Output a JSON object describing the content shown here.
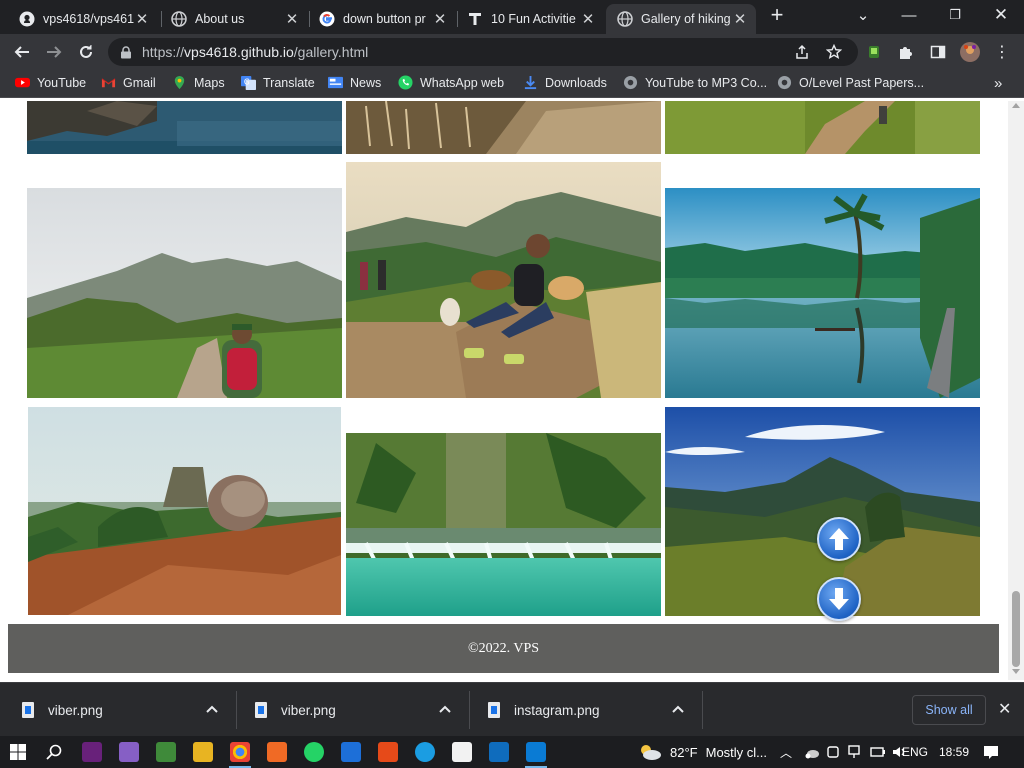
{
  "tabs": [
    {
      "title": "vps4618/vps461",
      "icon": "github-icon"
    },
    {
      "title": "About us",
      "icon": "globe-icon"
    },
    {
      "title": "down button pr",
      "icon": "google-icon"
    },
    {
      "title": "10 Fun Activitie",
      "icon": "t-logo-icon"
    },
    {
      "title": "Gallery of hiking",
      "icon": "globe-icon",
      "active": true
    }
  ],
  "address": {
    "scheme": "https://",
    "host": "vps4618.github.io",
    "path": "/gallery.html"
  },
  "bookmarks": [
    {
      "label": "YouTube",
      "color": "#ff0000"
    },
    {
      "label": "Gmail",
      "color": "#ea4335"
    },
    {
      "label": "Maps",
      "color": "#34a853"
    },
    {
      "label": "Translate",
      "color": "#4285f4"
    },
    {
      "label": "News",
      "color": "#4285f4"
    },
    {
      "label": "WhatsApp web",
      "color": "#25d366"
    },
    {
      "label": "Downloads",
      "color": "#4a8af4"
    },
    {
      "label": "YouTube to MP3 Co...",
      "color": "#9aa0a6"
    },
    {
      "label": "O/Level Past Papers...",
      "color": "#9aa0a6"
    }
  ],
  "bookmarks_overflow": "»",
  "gallery": {
    "photos": [
      {
        "name": "river-rocks-photo"
      },
      {
        "name": "dry-grass-hill-photo"
      },
      {
        "name": "trail-hiker-photo"
      },
      {
        "name": "hiker-green-valley-photo"
      },
      {
        "name": "woman-with-dogs-summit-photo"
      },
      {
        "name": "lake-palm-reflection-photo"
      },
      {
        "name": "sigiriya-rock-view-photo"
      },
      {
        "name": "waterfall-pool-photo"
      },
      {
        "name": "mountain-blue-sky-photo"
      }
    ]
  },
  "footer": {
    "text": "©2022. VPS"
  },
  "downloads": {
    "items": [
      "viber.png",
      "viber.png",
      "instagram.png"
    ],
    "show_all": "Show all"
  },
  "taskbar": {
    "weather_temp": "82°F",
    "weather_text": "Mostly cl...",
    "language": "ENG",
    "time": "18:59"
  },
  "colors": {
    "accent": "#8ab4f8",
    "footer_bg": "#5f5f5d",
    "chrome_dark": "#202124"
  }
}
